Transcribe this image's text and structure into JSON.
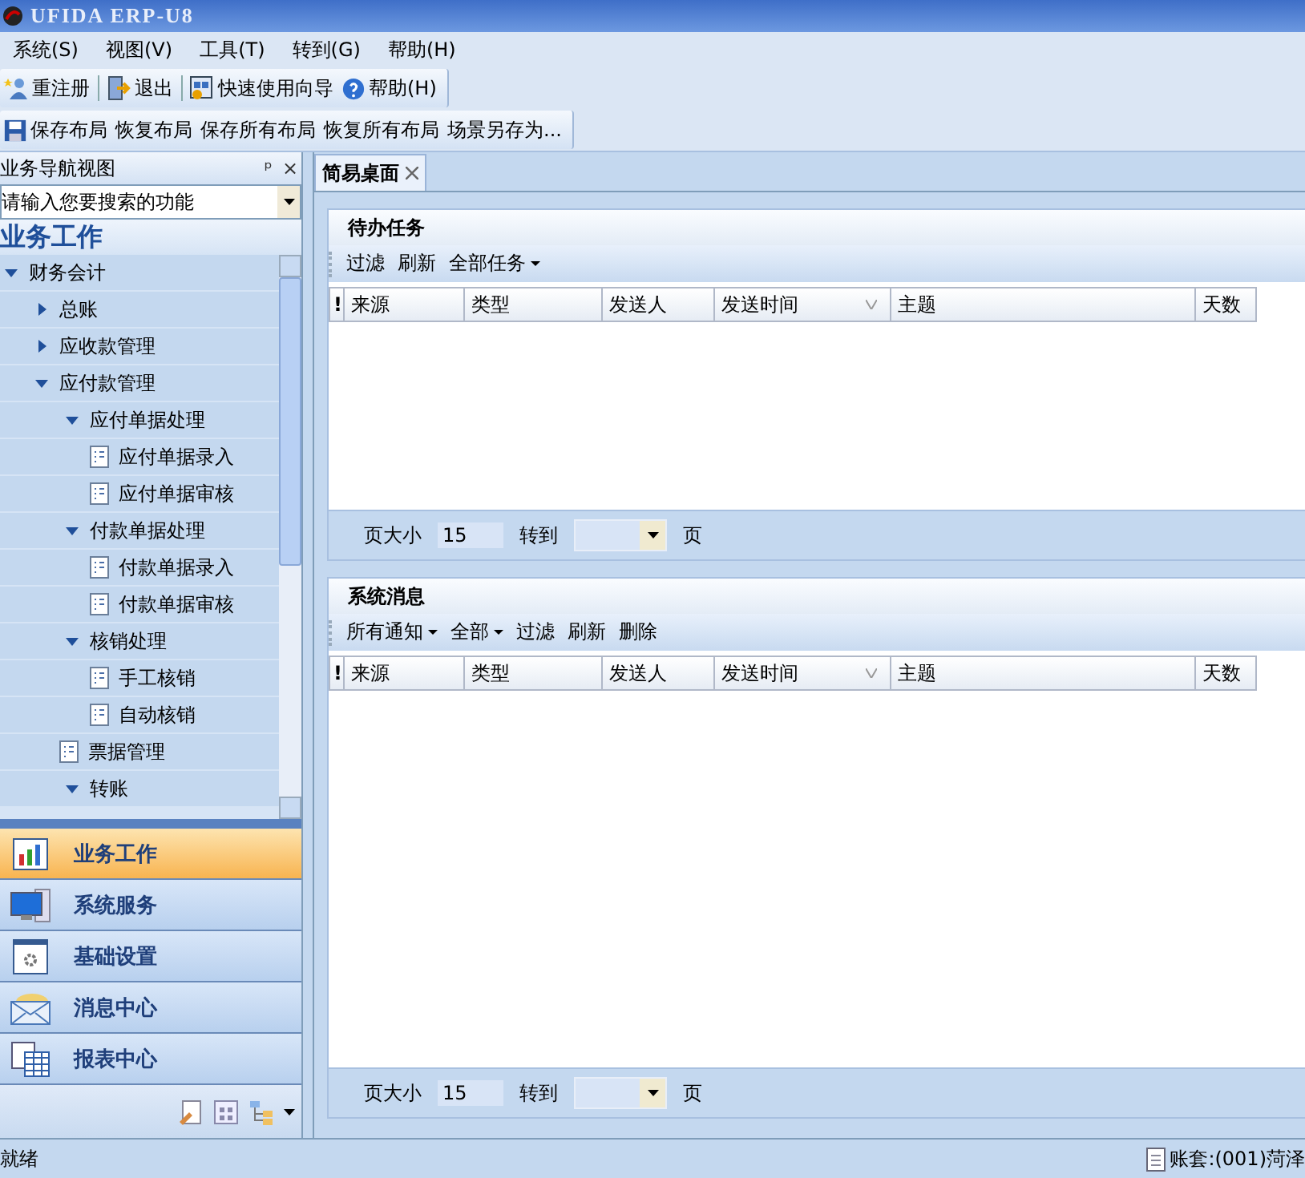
{
  "window": {
    "title": "UFIDA ERP-U8"
  },
  "menu": [
    "系统(S)",
    "视图(V)",
    "工具(T)",
    "转到(G)",
    "帮助(H)"
  ],
  "toolbar": [
    {
      "label": "重注册"
    },
    {
      "label": "退出"
    },
    {
      "label": "快速使用向导"
    },
    {
      "label": "帮助(H)"
    }
  ],
  "layout_toolbar": [
    {
      "label": "保存布局"
    },
    {
      "label": "恢复布局"
    },
    {
      "label": "保存所有布局"
    },
    {
      "label": "恢复所有布局"
    },
    {
      "label": "场景另存为..."
    }
  ],
  "sidebar": {
    "title": "业务导航视图",
    "pin": "ᵖ",
    "close": "×",
    "search": {
      "placeholder": "请输入您要搜索的功能"
    },
    "heading": "业务工作",
    "tree": [
      {
        "label": "财务会计",
        "kind": "group",
        "expanded": true,
        "children": [
          {
            "label": "总账",
            "kind": "group",
            "expanded": false
          },
          {
            "label": "应收款管理",
            "kind": "group",
            "expanded": false
          },
          {
            "label": "应付款管理",
            "kind": "group",
            "expanded": true,
            "children": [
              {
                "label": "应付单据处理",
                "kind": "group",
                "expanded": true,
                "children": [
                  {
                    "label": "应付单据录入",
                    "kind": "document"
                  },
                  {
                    "label": "应付单据审核",
                    "kind": "document"
                  }
                ]
              },
              {
                "label": "付款单据处理",
                "kind": "group",
                "expanded": true,
                "children": [
                  {
                    "label": "付款单据录入",
                    "kind": "document"
                  },
                  {
                    "label": "付款单据审核",
                    "kind": "document"
                  }
                ]
              },
              {
                "label": "核销处理",
                "kind": "group",
                "expanded": true,
                "children": [
                  {
                    "label": "手工核销",
                    "kind": "document"
                  },
                  {
                    "label": "自动核销",
                    "kind": "document"
                  }
                ]
              },
              {
                "label": "票据管理",
                "kind": "document"
              },
              {
                "label": "转账",
                "kind": "group",
                "expanded": true
              }
            ]
          }
        ]
      }
    ],
    "nav_buttons": [
      {
        "label": "业务工作",
        "selected": true
      },
      {
        "label": "系统服务",
        "selected": false
      },
      {
        "label": "基础设置",
        "selected": false
      },
      {
        "label": "消息中心",
        "selected": false
      },
      {
        "label": "报表中心",
        "selected": false
      }
    ]
  },
  "tabs": [
    {
      "label": "简易桌面",
      "selected": true
    }
  ],
  "panels": [
    {
      "title": "待办任务",
      "toolbar": [
        {
          "label": "过滤",
          "dropdown": false
        },
        {
          "label": "刷新",
          "dropdown": false
        },
        {
          "label": "全部任务",
          "dropdown": true
        }
      ],
      "columns": [
        "!",
        "来源",
        "类型",
        "发送人",
        "发送时间",
        "主题",
        "天数"
      ],
      "pager": {
        "size_label": "页大小",
        "size": "15",
        "goto_label": "转到",
        "page_label": "页"
      }
    },
    {
      "title": "系统消息",
      "toolbar": [
        {
          "label": "所有通知",
          "dropdown": true
        },
        {
          "label": "全部",
          "dropdown": true
        },
        {
          "label": "过滤",
          "dropdown": false
        },
        {
          "label": "刷新",
          "dropdown": false
        },
        {
          "label": "删除",
          "dropdown": false
        }
      ],
      "columns": [
        "!",
        "来源",
        "类型",
        "发送人",
        "发送时间",
        "主题",
        "天数"
      ],
      "pager": {
        "size_label": "页大小",
        "size": "15",
        "goto_label": "转到",
        "page_label": "页"
      }
    }
  ],
  "status_bar": {
    "left": "就绪",
    "right": "账套:(001)菏泽"
  }
}
